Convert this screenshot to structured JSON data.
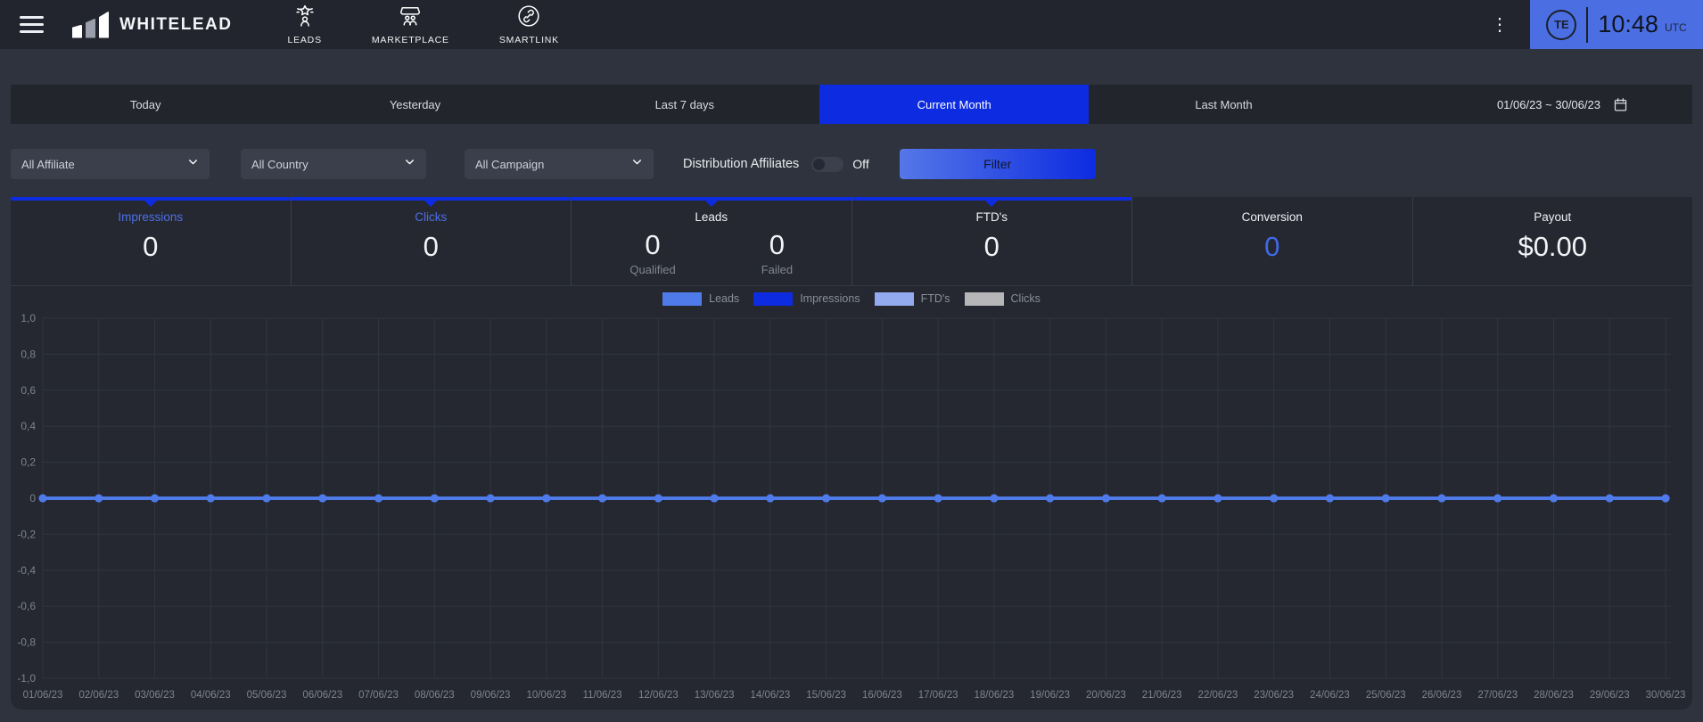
{
  "header": {
    "brand": "WHITELEAD",
    "nav": [
      {
        "label": "LEADS"
      },
      {
        "label": "MARKETPLACE"
      },
      {
        "label": "SMARTLINK"
      }
    ],
    "user_initials": "TE",
    "time": "10:48",
    "timezone": "UTC"
  },
  "tabs": {
    "items": [
      "Today",
      "Yesterday",
      "Last 7 days",
      "Current Month",
      "Last Month"
    ],
    "active_index": 3,
    "date_range": "01/06/23 ~ 30/06/23"
  },
  "filters": {
    "affiliate": "All Affiliate",
    "country": "All Country",
    "campaign": "All Campaign",
    "distribution_label": "Distribution Affiliates",
    "toggle_state": "Off",
    "filter_button": "Filter"
  },
  "stats": {
    "impressions": {
      "label": "Impressions",
      "value": "0"
    },
    "clicks": {
      "label": "Clicks",
      "value": "0"
    },
    "leads": {
      "label": "Leads",
      "qualified_value": "0",
      "qualified_label": "Qualified",
      "failed_value": "0",
      "failed_label": "Failed"
    },
    "ftds": {
      "label": "FTD's",
      "value": "0"
    },
    "conversion": {
      "label": "Conversion",
      "value": "0"
    },
    "payout": {
      "label": "Payout",
      "value": "$0.00"
    }
  },
  "chart_data": {
    "type": "line",
    "x": [
      "01/06/23",
      "02/06/23",
      "03/06/23",
      "04/06/23",
      "05/06/23",
      "06/06/23",
      "07/06/23",
      "08/06/23",
      "09/06/23",
      "10/06/23",
      "11/06/23",
      "12/06/23",
      "13/06/23",
      "14/06/23",
      "15/06/23",
      "16/06/23",
      "17/06/23",
      "18/06/23",
      "19/06/23",
      "20/06/23",
      "21/06/23",
      "22/06/23",
      "23/06/23",
      "24/06/23",
      "25/06/23",
      "26/06/23",
      "27/06/23",
      "28/06/23",
      "29/06/23",
      "30/06/23"
    ],
    "series": [
      {
        "name": "Leads",
        "color": "#4f7bea",
        "values": [
          0,
          0,
          0,
          0,
          0,
          0,
          0,
          0,
          0,
          0,
          0,
          0,
          0,
          0,
          0,
          0,
          0,
          0,
          0,
          0,
          0,
          0,
          0,
          0,
          0,
          0,
          0,
          0,
          0,
          0
        ]
      },
      {
        "name": "Impressions",
        "color": "#0d2be0",
        "values": [
          0,
          0,
          0,
          0,
          0,
          0,
          0,
          0,
          0,
          0,
          0,
          0,
          0,
          0,
          0,
          0,
          0,
          0,
          0,
          0,
          0,
          0,
          0,
          0,
          0,
          0,
          0,
          0,
          0,
          0
        ]
      },
      {
        "name": "FTD's",
        "color": "#93abee",
        "values": [
          0,
          0,
          0,
          0,
          0,
          0,
          0,
          0,
          0,
          0,
          0,
          0,
          0,
          0,
          0,
          0,
          0,
          0,
          0,
          0,
          0,
          0,
          0,
          0,
          0,
          0,
          0,
          0,
          0,
          0
        ]
      },
      {
        "name": "Clicks",
        "color": "#b6b6b8",
        "values": [
          0,
          0,
          0,
          0,
          0,
          0,
          0,
          0,
          0,
          0,
          0,
          0,
          0,
          0,
          0,
          0,
          0,
          0,
          0,
          0,
          0,
          0,
          0,
          0,
          0,
          0,
          0,
          0,
          0,
          0
        ]
      }
    ],
    "ylim": [
      -1.0,
      1.0
    ],
    "ytick_labels": [
      "1,0",
      "0,8",
      "0,6",
      "0,4",
      "0,2",
      "0",
      "-0,2",
      "-0,4",
      "-0,6",
      "-0,8",
      "-1,0"
    ],
    "grid": true,
    "legend_position": "top-center"
  }
}
